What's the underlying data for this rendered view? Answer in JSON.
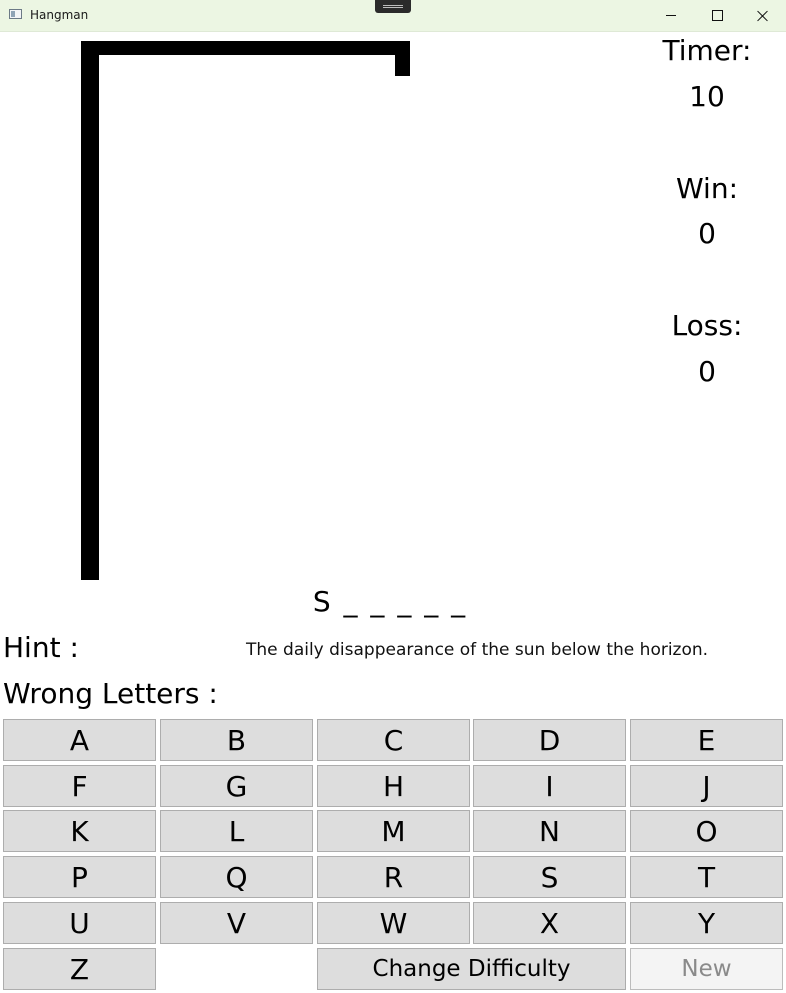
{
  "window": {
    "title": "Hangman",
    "icons": [
      "app-icon",
      "minimize-icon",
      "maximize-icon",
      "close-icon"
    ]
  },
  "stats": {
    "timer_label": "Timer:",
    "timer_value": "10",
    "win_label": "Win:",
    "win_value": "0",
    "loss_label": "Loss:",
    "loss_value": "0"
  },
  "word": {
    "display": "S _ _ _ _ _"
  },
  "hint": {
    "label": "Hint :",
    "text": "The daily disappearance of the sun below the horizon."
  },
  "wrong_letters": {
    "label": "Wrong Letters :"
  },
  "keyboard": {
    "letters": [
      "A",
      "B",
      "C",
      "D",
      "E",
      "F",
      "G",
      "H",
      "I",
      "J",
      "K",
      "L",
      "M",
      "N",
      "O",
      "P",
      "Q",
      "R",
      "S",
      "T",
      "U",
      "V",
      "W",
      "X",
      "Y",
      "Z"
    ],
    "change_difficulty_label": "Change Difficulty",
    "new_label": "New"
  },
  "colors": {
    "titlebar_bg": "#ecf6e3",
    "key_bg": "#dddddd",
    "key_border": "#adadad",
    "disabled_text": "#8a8a8a"
  }
}
